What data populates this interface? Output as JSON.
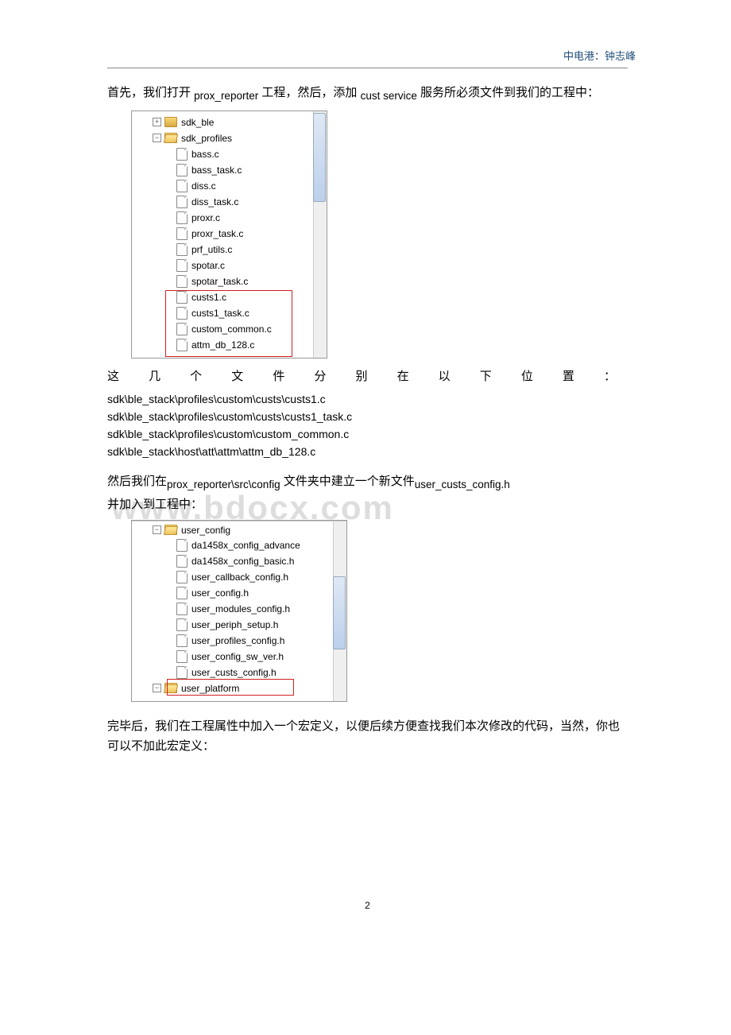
{
  "header": {
    "right": "中电港：钟志峰"
  },
  "para1": {
    "a": "首先，我们打开 ",
    "b": "prox_reporter",
    "c": " 工程，然后，添加 ",
    "d": "cust service",
    "e": " 服务所必须文件到我们的工程中："
  },
  "tree1": {
    "top": "sdk_ble",
    "folder": "sdk_profiles",
    "items": [
      "bass.c",
      "bass_task.c",
      "diss.c",
      "diss_task.c",
      "proxr.c",
      "proxr_task.c",
      "prf_utils.c",
      "spotar.c",
      "spotar_task.c",
      "custs1.c",
      "custs1_task.c",
      "custom_common.c",
      "attm_db_128.c"
    ]
  },
  "para2": "这 几 个 文 件 分 别 在 以 下 位 置 ：",
  "paths": [
    "sdk\\ble_stack\\profiles\\custom\\custs\\custs1.c",
    "sdk\\ble_stack\\profiles\\custom\\custs\\custs1_task.c",
    "sdk\\ble_stack\\profiles\\custom\\custom_common.c",
    "sdk\\ble_stack\\host\\att\\attm\\attm_db_128.c"
  ],
  "para3": {
    "a": "然后我们在",
    "b": "prox_reporter\\src\\config",
    "c": " 文件夹中建立一个新文件",
    "d": "user_custs_config.h",
    "e": "并加入到工程中："
  },
  "tree2": {
    "folder": "user_config",
    "items": [
      "da1458x_config_advance",
      "da1458x_config_basic.h",
      "user_callback_config.h",
      "user_config.h",
      "user_modules_config.h",
      "user_periph_setup.h",
      "user_profiles_config.h",
      "user_config_sw_ver.h",
      "user_custs_config.h"
    ],
    "bottom": "user_platform"
  },
  "para4": "完毕后，我们在工程属性中加入一个宏定义，以便后续方便查找我们本次修改的代码，当然，你也可以不加此宏定义：",
  "watermark": "www.bdocx.com",
  "pagenum": "2"
}
